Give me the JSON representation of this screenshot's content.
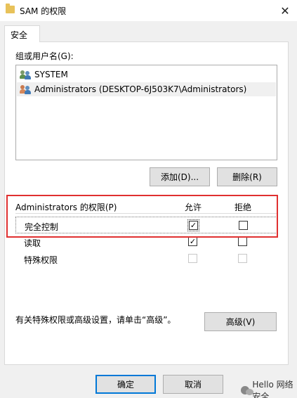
{
  "window": {
    "title": "SAM 的权限",
    "close_glyph": "✕"
  },
  "tabs": [
    {
      "label": "安全"
    }
  ],
  "groups": {
    "label": "组或用户名(G):",
    "items": [
      {
        "name": "SYSTEM",
        "icon": "users-icon",
        "selected": false
      },
      {
        "name": "Administrators (DESKTOP-6J503K7\\Administrators)",
        "icon": "users-icon",
        "selected": true
      }
    ],
    "add_label": "添加(D)...",
    "remove_label": "删除(R)"
  },
  "permissions": {
    "header_label": "Administrators 的权限(P)",
    "allow_header": "允许",
    "deny_header": "拒绝",
    "rows": [
      {
        "name": "完全控制",
        "allow": true,
        "deny": false,
        "disabled": false
      },
      {
        "name": "读取",
        "allow": true,
        "deny": false,
        "disabled": false
      },
      {
        "name": "特殊权限",
        "allow": false,
        "deny": false,
        "disabled": true
      }
    ],
    "check_glyph": "✓"
  },
  "advanced": {
    "hint": "有关特殊权限或高级设置，请单击“高级”。",
    "button_label": "高级(V)"
  },
  "footer": {
    "ok_label": "确定",
    "cancel_label": "取消"
  },
  "watermark": {
    "text": "Hello 网络安全"
  },
  "colors": {
    "highlight": "#e03030",
    "focus_border": "#0078d7",
    "folder": "#e8c25a"
  }
}
